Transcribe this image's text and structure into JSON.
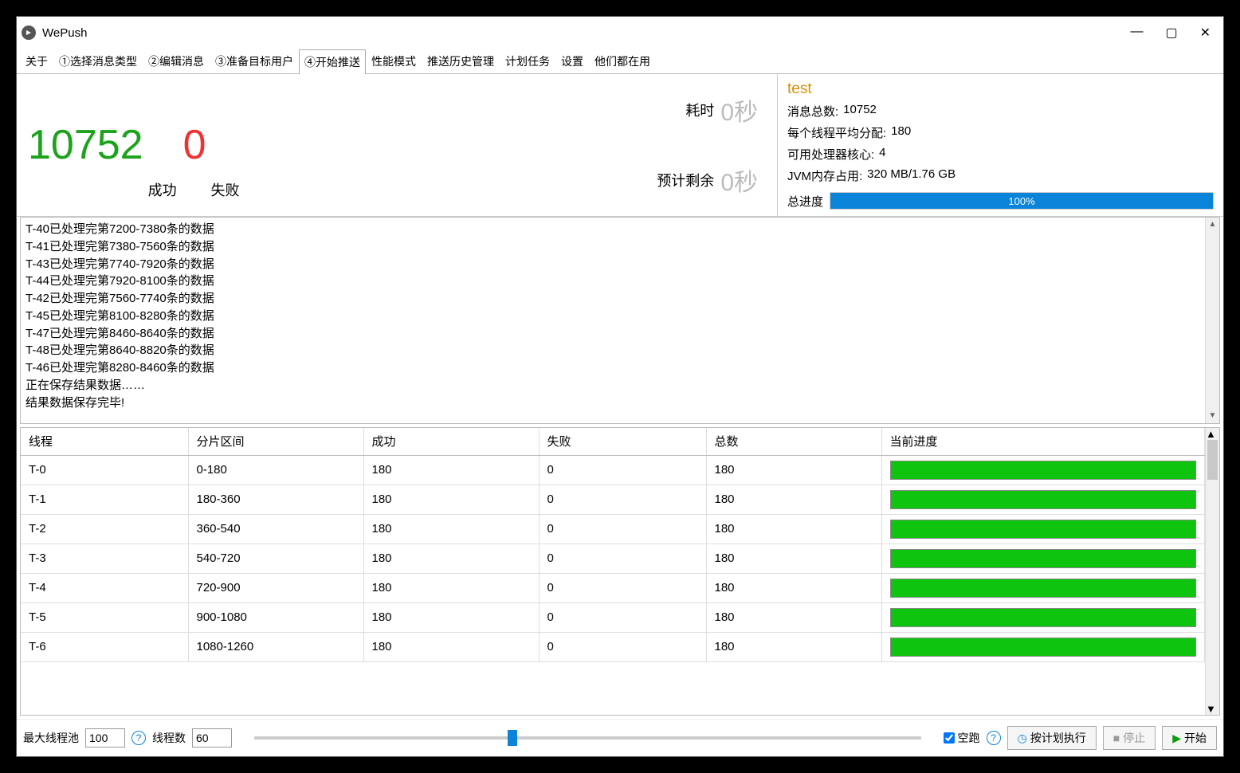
{
  "titlebar": {
    "title": "WePush"
  },
  "tabs": [
    "关于",
    "①选择消息类型",
    "②编辑消息",
    "③准备目标用户",
    "④开始推送",
    "性能模式",
    "推送历史管理",
    "计划任务",
    "设置",
    "他们都在用"
  ],
  "active_tab": 4,
  "stats": {
    "success_count": "10752",
    "success_label": "成功",
    "fail_count": "0",
    "fail_label": "失败",
    "elapsed_label": "耗时",
    "elapsed_value": "0秒",
    "eta_label": "预计剩余",
    "eta_value": "0秒"
  },
  "info": {
    "title": "test",
    "total_label": "消息总数:",
    "total_value": "10752",
    "avg_label": "每个线程平均分配:",
    "avg_value": "180",
    "cores_label": "可用处理器核心:",
    "cores_value": "4",
    "jvm_label": "JVM内存占用:",
    "jvm_value": "320 MB/1.76 GB",
    "progress_label": "总进度",
    "progress_text": "100%"
  },
  "log": [
    "T-40已处理完第7200-7380条的数据",
    "T-41已处理完第7380-7560条的数据",
    "T-43已处理完第7740-7920条的数据",
    "T-44已处理完第7920-8100条的数据",
    "T-42已处理完第7560-7740条的数据",
    "T-45已处理完第8100-8280条的数据",
    "T-47已处理完第8460-8640条的数据",
    "T-48已处理完第8640-8820条的数据",
    "T-46已处理完第8280-8460条的数据",
    "正在保存结果数据……",
    "结果数据保存完毕!"
  ],
  "table": {
    "headers": [
      "线程",
      "分片区间",
      "成功",
      "失败",
      "总数",
      "当前进度"
    ],
    "rows": [
      {
        "thread": "T-0",
        "range": "0-180",
        "success": "180",
        "fail": "0",
        "total": "180"
      },
      {
        "thread": "T-1",
        "range": "180-360",
        "success": "180",
        "fail": "0",
        "total": "180"
      },
      {
        "thread": "T-2",
        "range": "360-540",
        "success": "180",
        "fail": "0",
        "total": "180"
      },
      {
        "thread": "T-3",
        "range": "540-720",
        "success": "180",
        "fail": "0",
        "total": "180"
      },
      {
        "thread": "T-4",
        "range": "720-900",
        "success": "180",
        "fail": "0",
        "total": "180"
      },
      {
        "thread": "T-5",
        "range": "900-1080",
        "success": "180",
        "fail": "0",
        "total": "180"
      },
      {
        "thread": "T-6",
        "range": "1080-1260",
        "success": "180",
        "fail": "0",
        "total": "180"
      }
    ]
  },
  "bottom": {
    "pool_label": "最大线程池",
    "pool_value": "100",
    "threads_label": "线程数",
    "threads_value": "60",
    "dryrun_label": "空跑",
    "schedule_btn": "按计划执行",
    "stop_btn": "停止",
    "start_btn": "开始"
  }
}
